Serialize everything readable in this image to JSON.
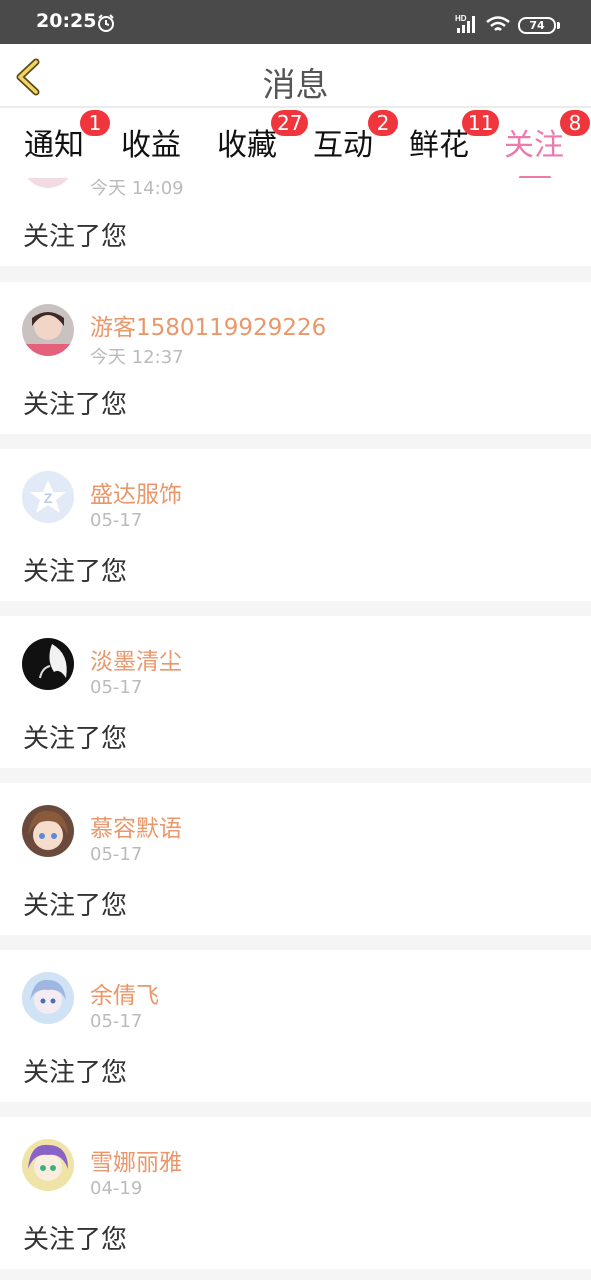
{
  "status_bar": {
    "time": "20:25",
    "battery": "74",
    "network": "HD"
  },
  "header": {
    "title": "消息"
  },
  "tabs": [
    {
      "label": "通知",
      "badge": "1"
    },
    {
      "label": "收益",
      "badge": ""
    },
    {
      "label": "收藏",
      "badge": "27"
    },
    {
      "label": "互动",
      "badge": "2"
    },
    {
      "label": "鲜花",
      "badge": "11"
    },
    {
      "label": "关注",
      "badge": "8",
      "active": true
    }
  ],
  "messages": [
    {
      "name": "",
      "time": "今天 14:09",
      "text": "关注了您",
      "avatar": "pink-avatar"
    },
    {
      "name": "游客1580119929226",
      "time": "今天 12:37",
      "text": "关注了您",
      "avatar": "girl-photo-avatar"
    },
    {
      "name": "盛达服饰",
      "time": "05-17",
      "text": "关注了您",
      "avatar": "qzone-star-avatar"
    },
    {
      "name": "淡墨清尘",
      "time": "05-17",
      "text": "关注了您",
      "avatar": "ink-portrait-avatar"
    },
    {
      "name": "慕容默语",
      "time": "05-17",
      "text": "关注了您",
      "avatar": "anime-girl-avatar"
    },
    {
      "name": "余倩飞",
      "time": "05-17",
      "text": "关注了您",
      "avatar": "blue-anime-avatar"
    },
    {
      "name": "雪娜丽雅",
      "time": "04-19",
      "text": "关注了您",
      "avatar": "purple-anime-avatar"
    }
  ],
  "colors": {
    "accent": "#ee79ad",
    "badge": "#f0353d",
    "username": "#e9976b",
    "timestamp": "#bbbbbb"
  }
}
